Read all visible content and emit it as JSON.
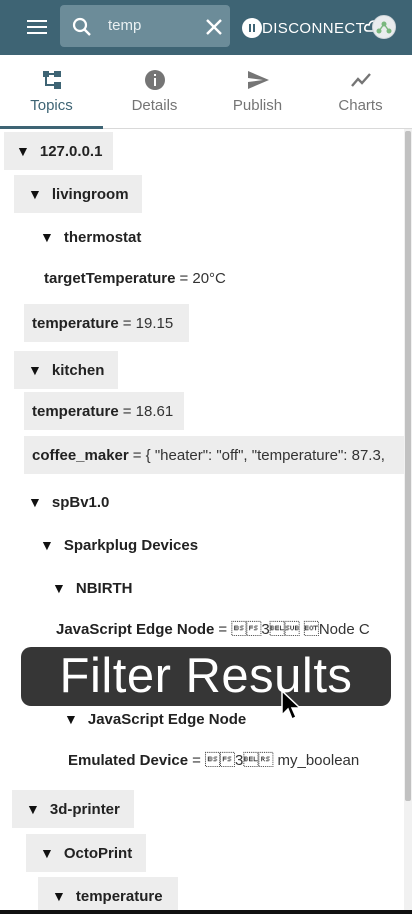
{
  "appbar": {
    "menu_icon": "hamburger-menu-icon",
    "search_value": "temp",
    "search_icon": "search-icon",
    "clear_icon": "close-icon",
    "disconnect_label": "DISCONNECT",
    "pause_icon": "pause-circle-icon",
    "cloud_icon": "cloud-off-icon",
    "color": "#3e6474"
  },
  "tabs": [
    {
      "label": "Topics",
      "icon": "topics-tree-icon",
      "active": true
    },
    {
      "label": "Details",
      "icon": "info-icon",
      "active": false
    },
    {
      "label": "Publish",
      "icon": "send-icon",
      "active": false
    },
    {
      "label": "Charts",
      "icon": "chart-line-icon",
      "active": false
    }
  ],
  "tree": [
    {
      "name": "127.0.0.1",
      "expanded": true
    },
    {
      "name": "livingroom",
      "expanded": true
    },
    {
      "name": "thermostat",
      "expanded": true
    },
    {
      "name": "targetTemperature",
      "value": "= 20°C"
    },
    {
      "name": "temperature",
      "value": "= 19.15"
    },
    {
      "name": "kitchen",
      "expanded": true
    },
    {
      "name": "temperature",
      "value": "= 18.61"
    },
    {
      "name": "coffee_maker",
      "value": "= { \"heater\": \"off\", \"temperature\": 87.3,"
    },
    {
      "name": "spBv1.0",
      "expanded": true
    },
    {
      "name": "Sparkplug Devices",
      "expanded": true
    },
    {
      "name": "NBIRTH",
      "expanded": true
    },
    {
      "name": "JavaScript Edge Node",
      "value": "= \b\u001c3\u0007\u001a \u0004Node C"
    },
    {
      "name": "JavaScript Edge Node",
      "expanded": true
    },
    {
      "name": "Emulated Device",
      "value": "= \b\u001c3\u0007\u001e my_boolean"
    },
    {
      "name": "3d-printer",
      "expanded": true
    },
    {
      "name": "OctoPrint",
      "expanded": true
    },
    {
      "name": "temperature",
      "expanded": true
    }
  ],
  "triangle": "▼",
  "overlay": {
    "text": "Filter Results"
  }
}
